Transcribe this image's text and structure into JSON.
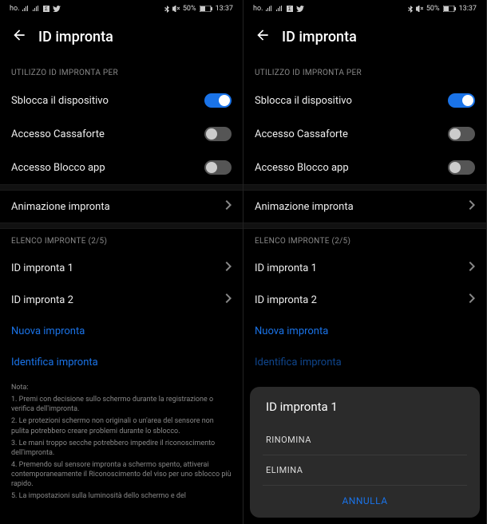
{
  "status": {
    "carrier": "ho.",
    "bluetooth": true,
    "battery_text": "50%",
    "time": "13:37"
  },
  "header": {
    "title": "ID impronta"
  },
  "sections": {
    "usage_label": "UTILIZZO ID IMPRONTA PER",
    "list_label": "ELENCO IMPRONTE (2/5)"
  },
  "toggles": {
    "unlock": {
      "label": "Sblocca il dispositivo",
      "on": true
    },
    "safebox": {
      "label": "Accesso Cassaforte",
      "on": false
    },
    "applock": {
      "label": "Accesso Blocco app",
      "on": false
    }
  },
  "animation": {
    "label": "Animazione impronta"
  },
  "fingerprints": [
    {
      "label": "ID impronta 1"
    },
    {
      "label": "ID impronta 2"
    }
  ],
  "links": {
    "new": "Nuova impronta",
    "identify": "Identifica impronta"
  },
  "notes": {
    "heading": "Nota:",
    "items": [
      "1. Premi con decisione sullo schermo durante la registrazione o verifica dell'impronta.",
      "2. Le protezioni schermo non originali o un'area del sensore non pulita potrebbero creare problemi durante lo sblocco.",
      "3. Le mani troppo secche potrebbero impedire il riconoscimento dell'impronta.",
      "4. Premendo sul sensore impronta a schermo spento, attiverai contemporaneamente il Riconoscimento del viso per uno sblocco più rapido.",
      "5. La impostazioni sulla luminosità dello schermo e del"
    ]
  },
  "dialog": {
    "title": "ID impronta 1",
    "rename": "RINOMINA",
    "delete": "ELIMINA",
    "cancel": "ANNULLA"
  }
}
